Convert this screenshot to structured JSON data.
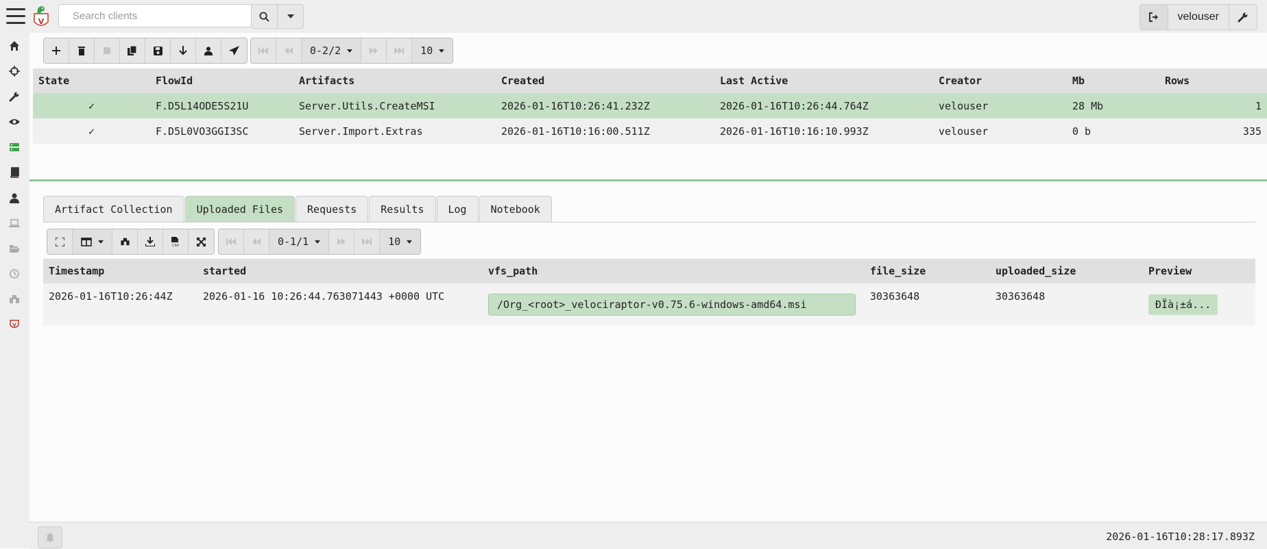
{
  "search": {
    "placeholder": "Search clients"
  },
  "user": {
    "name": "velouser"
  },
  "flow_pager": {
    "range": "0-2/2",
    "page_size": "10"
  },
  "flows": {
    "columns": [
      "State",
      "FlowId",
      "Artifacts",
      "Created",
      "Last Active",
      "Creator",
      "Mb",
      "Rows"
    ],
    "rows": [
      {
        "state": "✓",
        "flow_id": "F.D5L14ODE5S21U",
        "artifacts": "Server.Utils.CreateMSI",
        "created": "2026-01-16T10:26:41.232Z",
        "last_active": "2026-01-16T10:26:44.764Z",
        "creator": "velouser",
        "mb": "28 Mb",
        "rows": "1"
      },
      {
        "state": "✓",
        "flow_id": "F.D5L0VO3GGI3SC",
        "artifacts": "Server.Import.Extras",
        "created": "2026-01-16T10:16:00.511Z",
        "last_active": "2026-01-16T10:16:10.993Z",
        "creator": "velouser",
        "mb": "0 b",
        "rows": "335"
      }
    ]
  },
  "tabs": [
    "Artifact Collection",
    "Uploaded Files",
    "Requests",
    "Results",
    "Log",
    "Notebook"
  ],
  "active_tab": "Uploaded Files",
  "upload_pager": {
    "range": "0-1/1",
    "page_size": "10"
  },
  "uploads": {
    "columns": [
      "Timestamp",
      "started",
      "vfs_path",
      "file_size",
      "uploaded_size",
      "Preview"
    ],
    "rows": [
      {
        "timestamp": "2026-01-16T10:26:44Z",
        "started": "2026-01-16 10:26:44.763071443 +0000 UTC",
        "vfs_path": "/Org_<root>_velociraptor-v0.75.6-windows-amd64.msi",
        "file_size": "30363648",
        "uploaded_size": "30363648",
        "preview": "ÐÏà¡±á..."
      }
    ]
  },
  "footer": {
    "clock": "2026-01-16T10:28:17.893Z"
  },
  "colors": {
    "selected_row": "#c5dfc5",
    "accent_green": "#8fc98f"
  }
}
